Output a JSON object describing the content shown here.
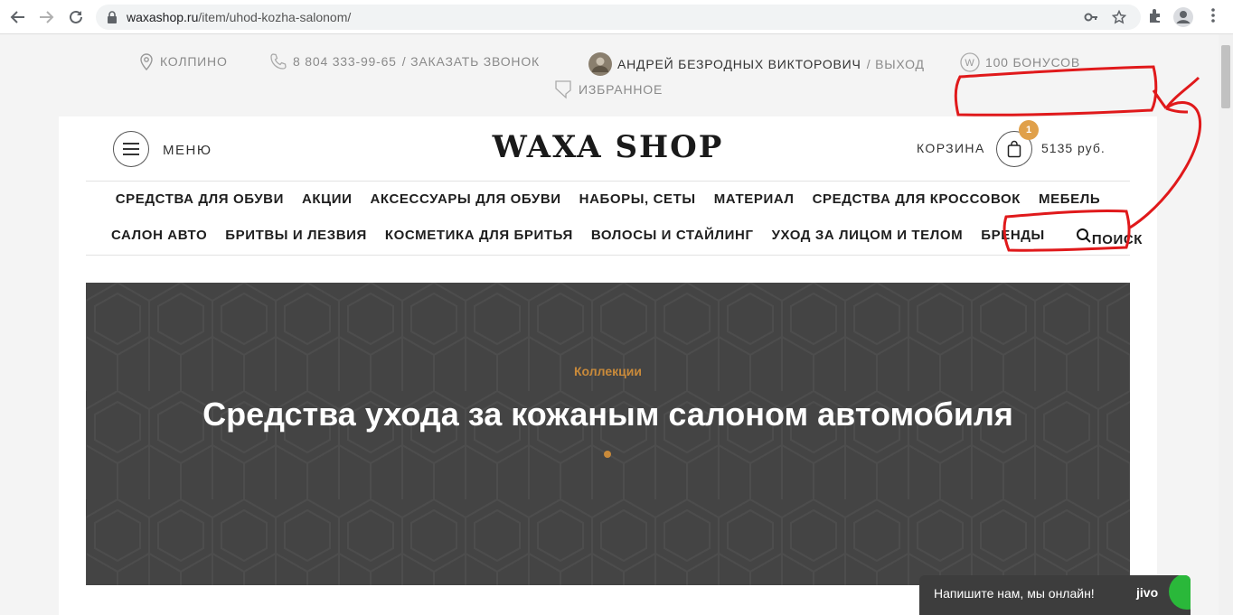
{
  "browser": {
    "url_host": "waxashop.ru",
    "url_path": "/item/uhod-kozha-salonom/"
  },
  "topbar": {
    "city": "КОЛПИНО",
    "phone": "8 804 333-99-65",
    "callback": "/ ЗАКАЗАТЬ ЗВОНОК",
    "user_name": "АНДРЕЙ БЕЗРОДНЫХ ВИКТОРОВИЧ",
    "logout": "/ ВЫХОД",
    "bonus": "100 БОНУСОВ",
    "favorites": "ИЗБРАННОЕ"
  },
  "header": {
    "menu_label": "МЕНЮ",
    "logo": "WAXA SHOP",
    "cart_label": "КОРЗИНА",
    "cart_count": "1",
    "cart_sum": "5135 руб."
  },
  "nav": {
    "row1": [
      "СРЕДСТВА ДЛЯ ОБУВИ",
      "АКЦИИ",
      "АКСЕССУАРЫ ДЛЯ ОБУВИ",
      "НАБОРЫ, СЕТЫ",
      "МАТЕРИАЛ",
      "СРЕДСТВА ДЛЯ КРОССОВОК",
      "МЕБЕЛЬ"
    ],
    "row2": [
      "САЛОН АВТО",
      "БРИТВЫ И ЛЕЗВИЯ",
      "КОСМЕТИКА ДЛЯ БРИТЬЯ",
      "ВОЛОСЫ И СТАЙЛИНГ",
      "УХОД ЗА ЛИЦОМ И ТЕЛОМ",
      "БРЕНДЫ"
    ],
    "search_label": "ПОИСК"
  },
  "hero": {
    "subtitle": "Коллекции",
    "title": "Средства ухода за кожаным салоном автомобиля"
  },
  "chat": {
    "text": "Напишите нам, мы онлайн!",
    "brand": "jivo"
  },
  "colors": {
    "accent": "#c98a3a",
    "badge": "#e0a04a",
    "hero_bg": "#444444",
    "annotation": "#e0191b"
  }
}
